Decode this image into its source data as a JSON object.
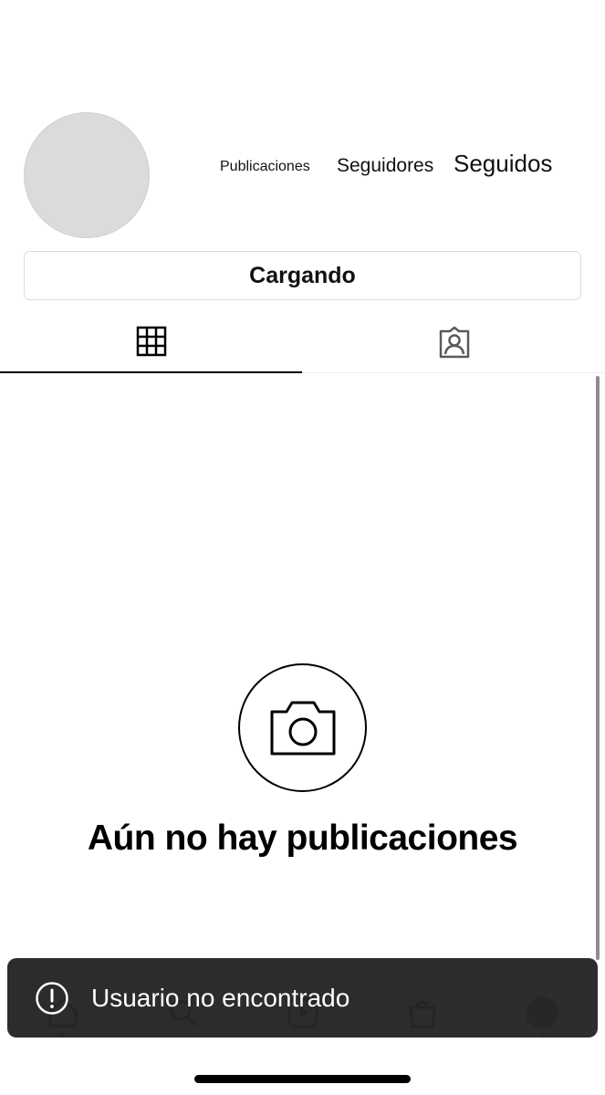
{
  "profile": {
    "stats": {
      "posts_label": "Publicaciones",
      "followers_label": "Seguidores",
      "following_label": "Seguidos"
    },
    "edit_button_label": "Cargando"
  },
  "tabs": [
    {
      "icon": "grid-icon",
      "active": true
    },
    {
      "icon": "tagged-person-icon",
      "active": false
    }
  ],
  "empty_state": {
    "icon": "camera-icon",
    "title": "Aún no hay publicaciones"
  },
  "bottom_nav": [
    {
      "icon": "home-icon"
    },
    {
      "icon": "search-icon"
    },
    {
      "icon": "reels-icon"
    },
    {
      "icon": "shop-icon"
    },
    {
      "icon": "profile-avatar"
    }
  ],
  "toast": {
    "icon": "alert-circle-icon",
    "message": "Usuario no encontrado"
  },
  "colors": {
    "background": "#ffffff",
    "avatar_placeholder": "#dbdbdb",
    "toast_background": "#262626",
    "notification_dot": "#e0245e"
  }
}
